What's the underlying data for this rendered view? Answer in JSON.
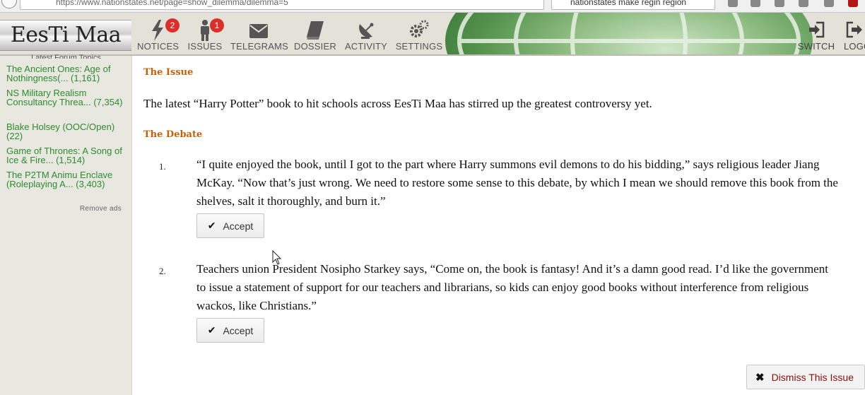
{
  "browser": {
    "url": "https://www.nationstates.net/page=show_dilemma/dilemma=5",
    "search_query": "nationstates make regin region"
  },
  "banner": {
    "nation_name": "EesTi Maa",
    "nav": [
      {
        "label": "NOTICES",
        "badge": "2"
      },
      {
        "label": "ISSUES",
        "badge": "1"
      },
      {
        "label": "TELEGRAMS"
      },
      {
        "label": "DOSSIER"
      },
      {
        "label": "ACTIVITY"
      },
      {
        "label": "SETTINGS"
      }
    ],
    "right_nav": [
      {
        "label": "SWITCH"
      },
      {
        "label": "LOGOUT"
      }
    ]
  },
  "sidebar": {
    "heading": "Latest Forum Topics",
    "forum_topics": [
      {
        "title": "The Ancient Ones: Age of Nothingness(... (1,161)"
      },
      {
        "title": "NS Military Realism Consultancy Threa... (7,354)"
      },
      {
        "title": "Blake Holsey (OOC/Open) (22)"
      },
      {
        "title": "Game of Thrones: A Song of Ice & Fire... (1,514)"
      },
      {
        "title": "The P2TM Animu Enclave (Roleplaying A... (3,403)"
      }
    ],
    "remove_ads": "Remove ads"
  },
  "issue": {
    "issue_heading": "The Issue",
    "issue_text": "The latest “Harry Potter” book to hit schools across EesTi Maa has stirred up the greatest controversy yet.",
    "debate_heading": "The Debate",
    "options": [
      {
        "number": "1.",
        "text": "“I quite enjoyed the book, until I got to the part where Harry summons evil demons to do his bidding,” says religious leader Jiang McKay. “Now that’s just wrong. We need to restore some sense to this debate, by which I mean we should remove this book from the shelves, salt it thoroughly, and burn it.”",
        "accept_label": "Accept"
      },
      {
        "number": "2.",
        "text": "Teachers union President Nosipho Starkey says, “Come on, the book is fantasy! And it’s a damn good read. I’d like the government to issue a statement of support for our teachers and librarians, so kids can enjoy good books without interference from religious wackos, like Christians.”",
        "accept_label": "Accept"
      }
    ],
    "dismiss_label": "Dismiss This Issue"
  },
  "colors": {
    "heading_orange": "#c0620c",
    "forum_link_green": "#2e8b2e",
    "badge_red": "#d9302c",
    "dismiss_red": "#8b0d0d"
  }
}
